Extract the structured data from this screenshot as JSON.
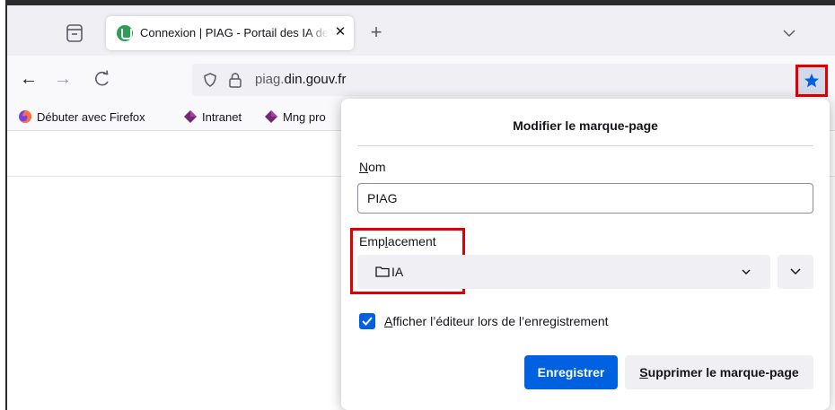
{
  "tab": {
    "title": "Connexion | PIAG - Portail des IA de la gendarmerie",
    "close_glyph": "✕",
    "new_tab_glyph": "+"
  },
  "nav": {
    "back_glyph": "←",
    "forward_glyph": "→",
    "reload_glyph": "C",
    "url_prefix": "piag.",
    "url_domain": "din.gouv.fr"
  },
  "bookmarks": {
    "items": [
      {
        "label": "Débuter avec Firefox",
        "icon": "firefox-icon"
      },
      {
        "label": "Intranet",
        "icon": "diamond-icon"
      },
      {
        "label": "Mng pro",
        "icon": "diamond-icon"
      }
    ],
    "overflow_glyph": "›"
  },
  "panel": {
    "title": "Modifier le marque-page",
    "name_label_accel": "N",
    "name_label_rest": "om",
    "name_value": "PIAG",
    "location_label_pre": "Emp",
    "location_label_accel": "l",
    "location_label_post": "acement",
    "folder_name": "IA",
    "checkbox_accel": "A",
    "checkbox_label_rest": "fficher l’éditeur lors de l’enregistrement",
    "checkbox_checked": true,
    "save_label": "Enregistrer",
    "remove_accel": "S",
    "remove_label_rest": "upprimer le marque-page"
  },
  "colors": {
    "accent": "#0061e0",
    "highlight_box": "#e00000",
    "star_bg": "#d2d9e8"
  }
}
